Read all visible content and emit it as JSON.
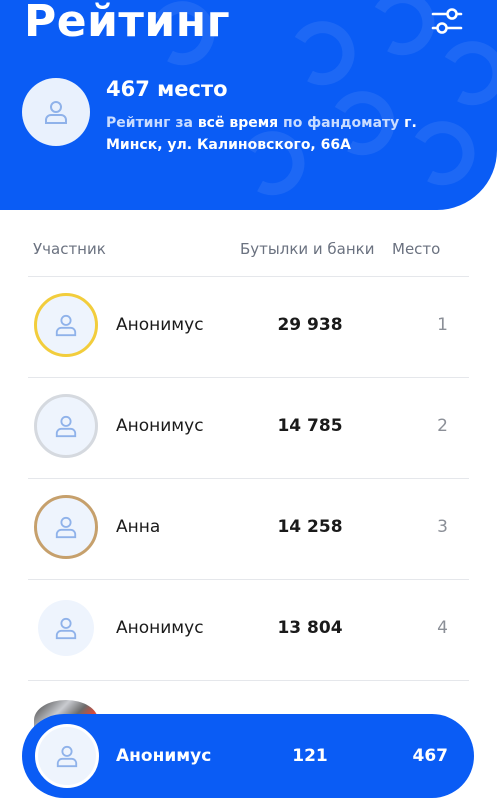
{
  "header": {
    "title": "Рейтинг",
    "place_title": "467 место",
    "desc_prefix": "Рейтинг за ",
    "desc_period": "всё время",
    "desc_middle": " по фандомату ",
    "desc_address": "г. Минск, ул. Калиновского, 66А",
    "filter_icon": "sliders-icon",
    "avatar_icon": "user-icon"
  },
  "table": {
    "col_participant": "Участник",
    "col_bottles": "Бутылки и банки",
    "col_place": "Место",
    "rows": [
      {
        "name": "Анонимус",
        "count": "29 938",
        "place": "1",
        "ring": "gold"
      },
      {
        "name": "Анонимус",
        "count": "14 785",
        "place": "2",
        "ring": "silver"
      },
      {
        "name": "Анна",
        "count": "14 258",
        "place": "3",
        "ring": "bronze"
      },
      {
        "name": "Анонимус",
        "count": "13 804",
        "place": "4",
        "ring": "none"
      }
    ]
  },
  "my_row": {
    "name": "Анонимус",
    "count": "121",
    "place": "467"
  },
  "colors": {
    "brand_blue": "#0a5cf5",
    "gold": "#f2cd3c",
    "silver": "#d5d9df",
    "bronze": "#c6a06c"
  }
}
